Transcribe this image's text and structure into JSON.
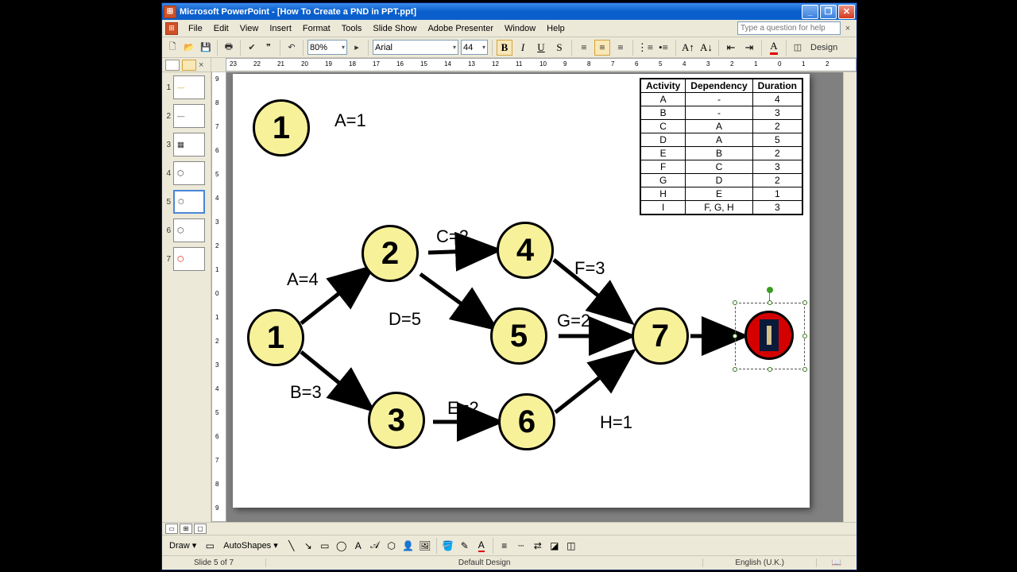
{
  "window": {
    "app_name": "Microsoft PowerPoint",
    "doc_name": "[How To Create a PND in PPT.ppt]"
  },
  "menu": {
    "file": "File",
    "edit": "Edit",
    "view": "View",
    "insert": "Insert",
    "format": "Format",
    "tools": "Tools",
    "slideshow": "Slide Show",
    "adobe": "Adobe Presenter",
    "window": "Window",
    "help": "Help",
    "help_placeholder": "Type a question for help"
  },
  "toolbar": {
    "zoom": "80%",
    "font": "Arial",
    "font_size": "44",
    "design": "Design"
  },
  "drawbar": {
    "draw": "Draw ▾",
    "autoshapes": "AutoShapes ▾"
  },
  "status": {
    "slide": "Slide 5 of 7",
    "template": "Default Design",
    "lang": "English (U.K.)"
  },
  "slides": {
    "count": 7,
    "selected": 5
  },
  "diagram": {
    "legend_node": "1",
    "legend_label": "A=1",
    "nodes": {
      "n1": "1",
      "n2": "2",
      "n3": "3",
      "n4": "4",
      "n5": "5",
      "n6": "6",
      "n7": "7"
    },
    "edges": {
      "A": "A=4",
      "B": "B=3",
      "C": "C=2",
      "D": "D=5",
      "E": "E=2",
      "F": "F=3",
      "G": "G=2",
      "H": "H=1"
    }
  },
  "table": {
    "headers": {
      "activity": "Activity",
      "dependency": "Dependency",
      "duration": "Duration"
    },
    "rows": [
      {
        "a": "A",
        "d": "-",
        "t": "4"
      },
      {
        "a": "B",
        "d": "-",
        "t": "3"
      },
      {
        "a": "C",
        "d": "A",
        "t": "2"
      },
      {
        "a": "D",
        "d": "A",
        "t": "5"
      },
      {
        "a": "E",
        "d": "B",
        "t": "2"
      },
      {
        "a": "F",
        "d": "C",
        "t": "3"
      },
      {
        "a": "G",
        "d": "D",
        "t": "2"
      },
      {
        "a": "H",
        "d": "E",
        "t": "1"
      },
      {
        "a": "I",
        "d": "F, G, H",
        "t": "3"
      }
    ]
  }
}
